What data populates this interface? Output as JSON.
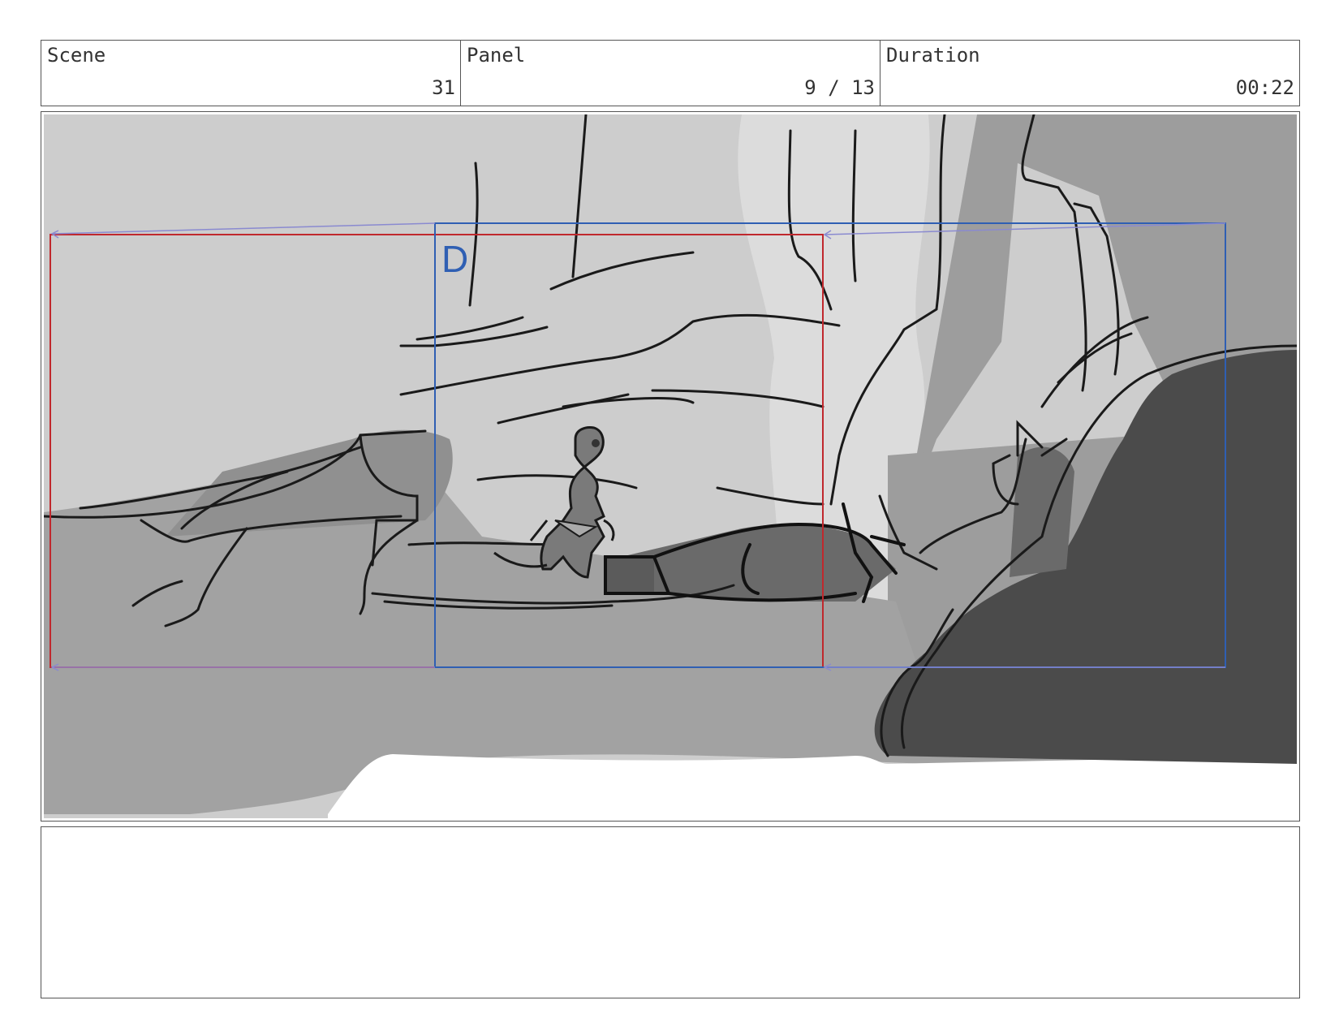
{
  "header": {
    "scene_label": "Scene",
    "scene_value": "31",
    "panel_label": "Panel",
    "panel_value": "9 / 13",
    "duration_label": "Duration",
    "duration_value": "00:22"
  },
  "panel": {
    "camera_frame_letter": "D",
    "colors": {
      "start_frame": "#c0282d",
      "end_frame": "#2f5fb3",
      "move_arrows": "#8a8ad0"
    }
  },
  "notes": {
    "text": ""
  }
}
